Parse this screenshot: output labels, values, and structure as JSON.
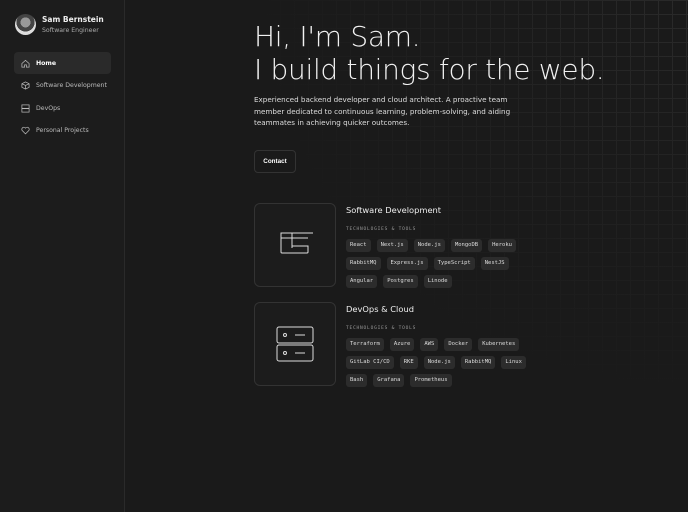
{
  "profile": {
    "name": "Sam Bernstein",
    "role": "Software Engineer"
  },
  "nav": [
    {
      "label": "Home",
      "icon": "home-icon"
    },
    {
      "label": "Software Development",
      "icon": "cube-icon"
    },
    {
      "label": "DevOps",
      "icon": "server-icon"
    },
    {
      "label": "Personal Projects",
      "icon": "heart-icon"
    }
  ],
  "hero": {
    "line1": "Hi, I'm Sam.",
    "line2": "I build things for the web.",
    "intro": "Experienced backend developer and cloud architect. A proactive team member dedicated to continuous learning, problem-solving, and aiding teammates in achieving quicker outcomes.",
    "contact": "Contact"
  },
  "cards": [
    {
      "title": "Software Development",
      "subtitle": "TECHNOLOGIES & TOOLS",
      "tags": [
        "React",
        "Next.js",
        "Node.js",
        "MongoDB",
        "Heroku",
        "RabbitMQ",
        "Express.js",
        "TypeScript",
        "NestJS",
        "Angular",
        "Postgres",
        "Linode"
      ]
    },
    {
      "title": "DevOps & Cloud",
      "subtitle": "TECHNOLOGIES & TOOLS",
      "tags": [
        "Terraform",
        "Azure",
        "AWS",
        "Docker",
        "Kubernetes",
        "GitLab CI/CD",
        "RKE",
        "Node.js",
        "RabbitMQ",
        "Linux",
        "Bash",
        "Grafana",
        "Prometheus"
      ]
    }
  ]
}
